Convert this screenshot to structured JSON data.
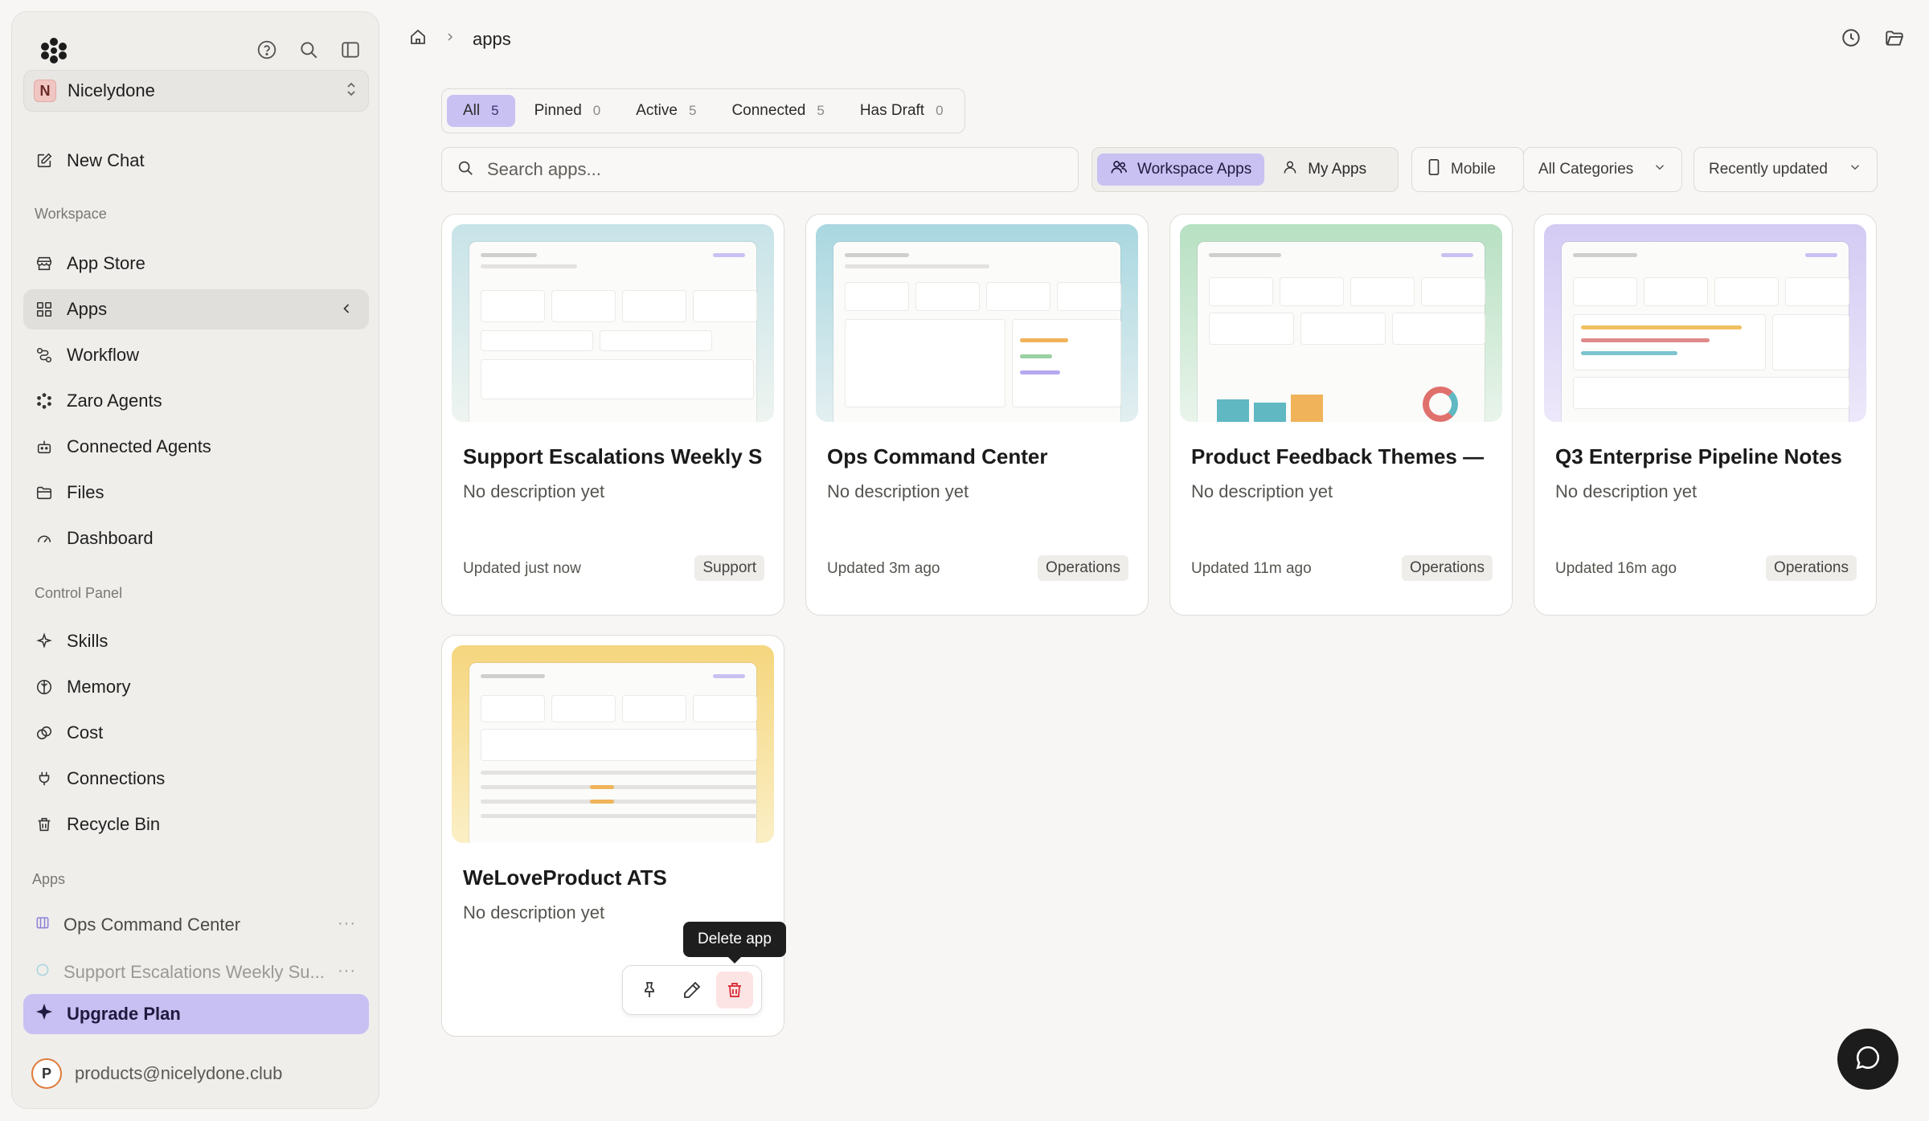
{
  "sidebar": {
    "workspace_name": "Nicelydone",
    "workspace_initial": "N",
    "new_chat": "New Chat",
    "workspace_label": "Workspace",
    "workspace_items": [
      {
        "label": "App Store",
        "icon": "store-icon"
      },
      {
        "label": "Apps",
        "icon": "grid-icon"
      },
      {
        "label": "Workflow",
        "icon": "workflow-icon"
      },
      {
        "label": "Zaro Agents",
        "icon": "agents-icon"
      },
      {
        "label": "Connected Agents",
        "icon": "bot-icon"
      },
      {
        "label": "Files",
        "icon": "folder-icon"
      },
      {
        "label": "Dashboard",
        "icon": "gauge-icon"
      }
    ],
    "control_panel_label": "Control Panel",
    "control_items": [
      {
        "label": "Skills",
        "icon": "sparkle-icon"
      },
      {
        "label": "Memory",
        "icon": "brain-icon"
      },
      {
        "label": "Cost",
        "icon": "coins-icon"
      },
      {
        "label": "Connections",
        "icon": "plug-icon"
      },
      {
        "label": "Recycle Bin",
        "icon": "trash-icon"
      }
    ],
    "apps_label": "Apps",
    "app_items": [
      {
        "label": "Ops Command Center",
        "dots": "···"
      },
      {
        "label": "Support Escalations Weekly Su...",
        "dots": "···"
      }
    ],
    "upgrade": "Upgrade Plan",
    "user_initial": "P",
    "user_email": "products@nicelydone.club"
  },
  "breadcrumb": {
    "current": "apps"
  },
  "tabs": [
    {
      "label": "All",
      "count": "5"
    },
    {
      "label": "Pinned",
      "count": "0"
    },
    {
      "label": "Active",
      "count": "5"
    },
    {
      "label": "Connected",
      "count": "5"
    },
    {
      "label": "Has Draft",
      "count": "0"
    }
  ],
  "search": {
    "placeholder": "Search apps..."
  },
  "scope": {
    "workspace": "Workspace Apps",
    "mine": "My Apps"
  },
  "filters": {
    "mobile": "Mobile",
    "category": "All Categories",
    "sort": "Recently updated"
  },
  "cards": [
    {
      "title": "Support Escalations Weekly Su...",
      "desc": "No description yet",
      "updated": "Updated just now",
      "tag": "Support",
      "gradient": [
        "#cfe6ea",
        "#eef3ef"
      ]
    },
    {
      "title": "Ops Command Center",
      "desc": "No description yet",
      "updated": "Updated 3m ago",
      "tag": "Operations",
      "gradient": [
        "#a8d8e0",
        "#e4f0f2"
      ]
    },
    {
      "title": "Product Feedback Themes — ...",
      "desc": "No description yet",
      "updated": "Updated 11m ago",
      "tag": "Operations",
      "gradient": [
        "#bfe3c8",
        "#eaf4ec"
      ]
    },
    {
      "title": "Q3 Enterprise Pipeline Notes",
      "desc": "No description yet",
      "updated": "Updated 16m ago",
      "tag": "Operations",
      "gradient": [
        "#d8d0f4",
        "#eee9fb"
      ]
    },
    {
      "title": "WeLoveProduct ATS",
      "desc": "No description yet",
      "updated": "",
      "tag": "",
      "gradient": [
        "#f6dc8c",
        "#fbefc8"
      ]
    }
  ],
  "tooltip": "Delete app",
  "colors": {
    "accent": "#c9c1f2",
    "danger": "#d9363e"
  }
}
